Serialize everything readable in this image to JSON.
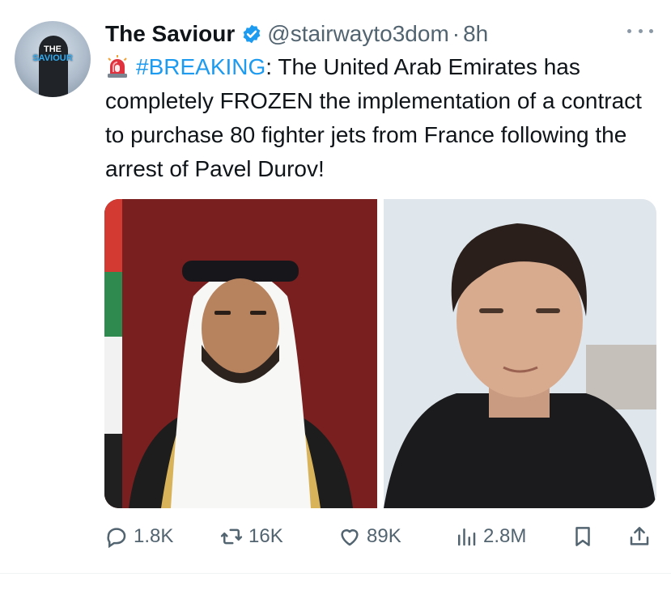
{
  "author": {
    "name": "The Saviour",
    "handle": "@stairwayto3dom",
    "separator": "·",
    "time": "8h",
    "avatar_text_line1": "THE",
    "avatar_text_line2": "SAVIOUR"
  },
  "tweet": {
    "hashtag": "#BREAKING",
    "body": ": The United Arab Emirates has completely FROZEN the implementation of a contract to purchase 80 fighter jets from France following the arrest of Pavel Durov!"
  },
  "media": {
    "left_image": "photo-uae-leader",
    "right_image": "photo-pavel-durov"
  },
  "actions": {
    "replies": "1.8K",
    "reposts": "16K",
    "likes": "89K",
    "views": "2.8M"
  },
  "colors": {
    "accent": "#1d9bf0",
    "muted": "#536471",
    "text": "#0f1419"
  },
  "icons": [
    "verified-badge-icon",
    "more-icon",
    "siren-icon",
    "reply-icon",
    "repost-icon",
    "like-icon",
    "views-icon",
    "bookmark-icon",
    "share-icon"
  ]
}
